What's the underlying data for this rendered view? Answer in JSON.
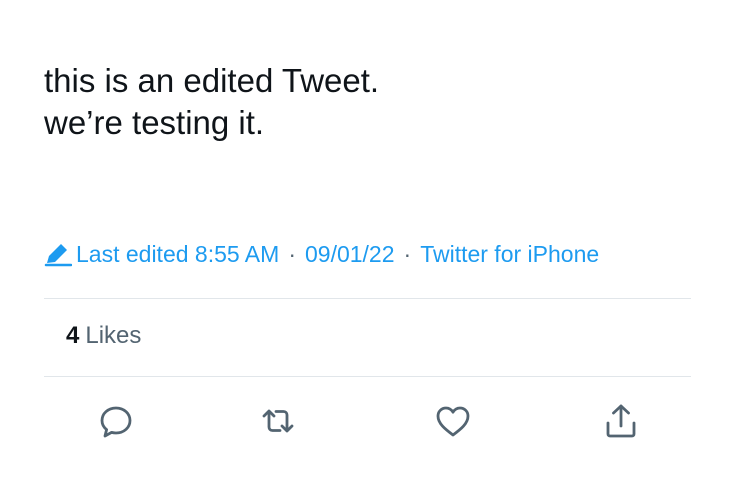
{
  "tweet": {
    "lines": [
      "this is an edited Tweet.",
      "we’re testing it."
    ]
  },
  "meta": {
    "edit_icon": "pencil-icon",
    "last_edited_label": "Last edited",
    "time": "8:55 AM",
    "separator": "·",
    "date": "09/01/22",
    "source": "Twitter for iPhone"
  },
  "engagement": {
    "likes_count": "4",
    "likes_label": "Likes"
  },
  "actions": [
    {
      "icon": "reply-icon"
    },
    {
      "icon": "retweet-icon"
    },
    {
      "icon": "heart-icon"
    },
    {
      "icon": "share-icon"
    }
  ],
  "colors": {
    "text": "#0f1419",
    "secondary": "#536471",
    "accent": "#1d9bf0",
    "divider": "#e1e6ea"
  }
}
